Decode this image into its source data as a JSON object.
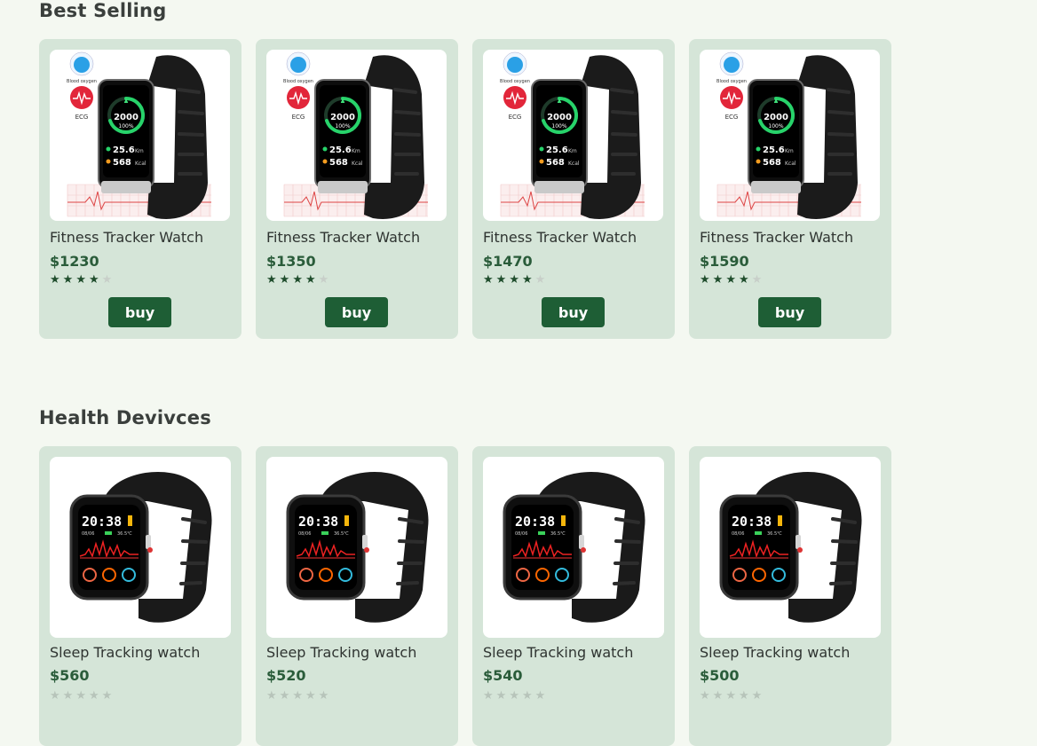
{
  "sections": [
    {
      "title": "Best Selling",
      "products": [
        {
          "name": "Fitness Tracker Watch",
          "price": "$1230",
          "rating": 4,
          "buy_label": "buy",
          "screen": {
            "steps": "2000",
            "percent": "100%",
            "km": "25.6",
            "km_unit": "Km",
            "kcal": "568",
            "kcal_unit": "Kcal",
            "badge1": "Blood oxygen",
            "badge2": "ECG"
          }
        },
        {
          "name": "Fitness Tracker Watch",
          "price": "$1350",
          "rating": 4,
          "buy_label": "buy",
          "screen": {
            "steps": "2000",
            "percent": "100%",
            "km": "25.6",
            "km_unit": "Km",
            "kcal": "568",
            "kcal_unit": "Kcal",
            "badge1": "Blood oxygen",
            "badge2": "ECG"
          }
        },
        {
          "name": "Fitness Tracker Watch",
          "price": "$1470",
          "rating": 4,
          "buy_label": "buy",
          "screen": {
            "steps": "2000",
            "percent": "100%",
            "km": "25.6",
            "km_unit": "Km",
            "kcal": "568",
            "kcal_unit": "Kcal",
            "badge1": "Blood oxygen",
            "badge2": "ECG"
          }
        },
        {
          "name": "Fitness Tracker Watch",
          "price": "$1590",
          "rating": 4,
          "buy_label": "buy",
          "screen": {
            "steps": "2000",
            "percent": "100%",
            "km": "25.6",
            "km_unit": "Km",
            "kcal": "568",
            "kcal_unit": "Kcal",
            "badge1": "Blood oxygen",
            "badge2": "ECG"
          }
        }
      ]
    },
    {
      "title": "Health Devivces",
      "products": [
        {
          "name": "Sleep Tracking watch",
          "price": "$560",
          "screen": {
            "time": "20:38",
            "date": "08/06",
            "temp": "36.5℃"
          }
        },
        {
          "name": "Sleep Tracking watch",
          "price": "$520",
          "screen": {
            "time": "20:38",
            "date": "08/06",
            "temp": "36.5℃"
          }
        },
        {
          "name": "Sleep Tracking watch",
          "price": "$540",
          "screen": {
            "time": "20:38",
            "date": "08/06",
            "temp": "36.5℃"
          }
        },
        {
          "name": "Sleep Tracking watch",
          "price": "$500",
          "screen": {
            "time": "20:38",
            "date": "08/06",
            "temp": "36.5℃"
          }
        }
      ]
    }
  ],
  "colors": {
    "background": "#f4f8f1",
    "card": "#d5e5d8",
    "accent": "#1e5e35",
    "price": "#2a5c3a"
  },
  "icons": {
    "star": "star-icon",
    "oxygen": "blood-oxygen-icon",
    "ecg": "ecg-heart-icon"
  }
}
